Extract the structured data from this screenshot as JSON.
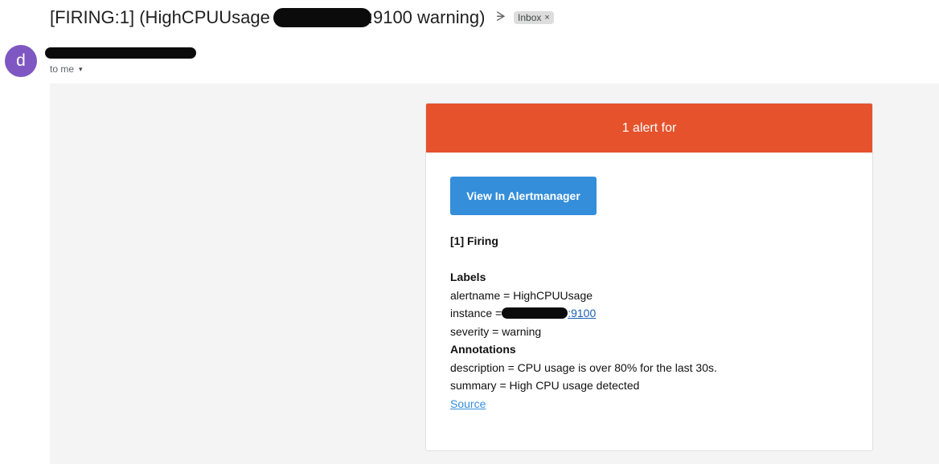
{
  "email": {
    "subject_prefix": "[FIRING:1] (HighCPUUsage",
    "subject_suffix": ":9100 warning)",
    "important_icon": "importance-marker-icon",
    "label_chip": "Inbox",
    "label_remove": "×",
    "avatar_letter": "d",
    "recipient": "to me",
    "recipient_caret": "▾"
  },
  "alert": {
    "header_title": "1 alert for",
    "button_label": "View In Alertmanager",
    "firing_title": "[1] Firing",
    "labels_heading": "Labels",
    "alertname": "alertname = HighCPUUsage",
    "instance_prefix": "instance = ",
    "instance_port": ":9100",
    "severity": "severity = warning",
    "annotations_heading": "Annotations",
    "description": "description = CPU usage is over 80% for the last 30s.",
    "summary": "summary = High CPU usage detected",
    "source_link": "Source"
  },
  "colors": {
    "header_bg": "#e6522c",
    "button_bg": "#348eda",
    "avatar_bg": "#7e57c2",
    "body_bg": "#f4f4f4"
  }
}
